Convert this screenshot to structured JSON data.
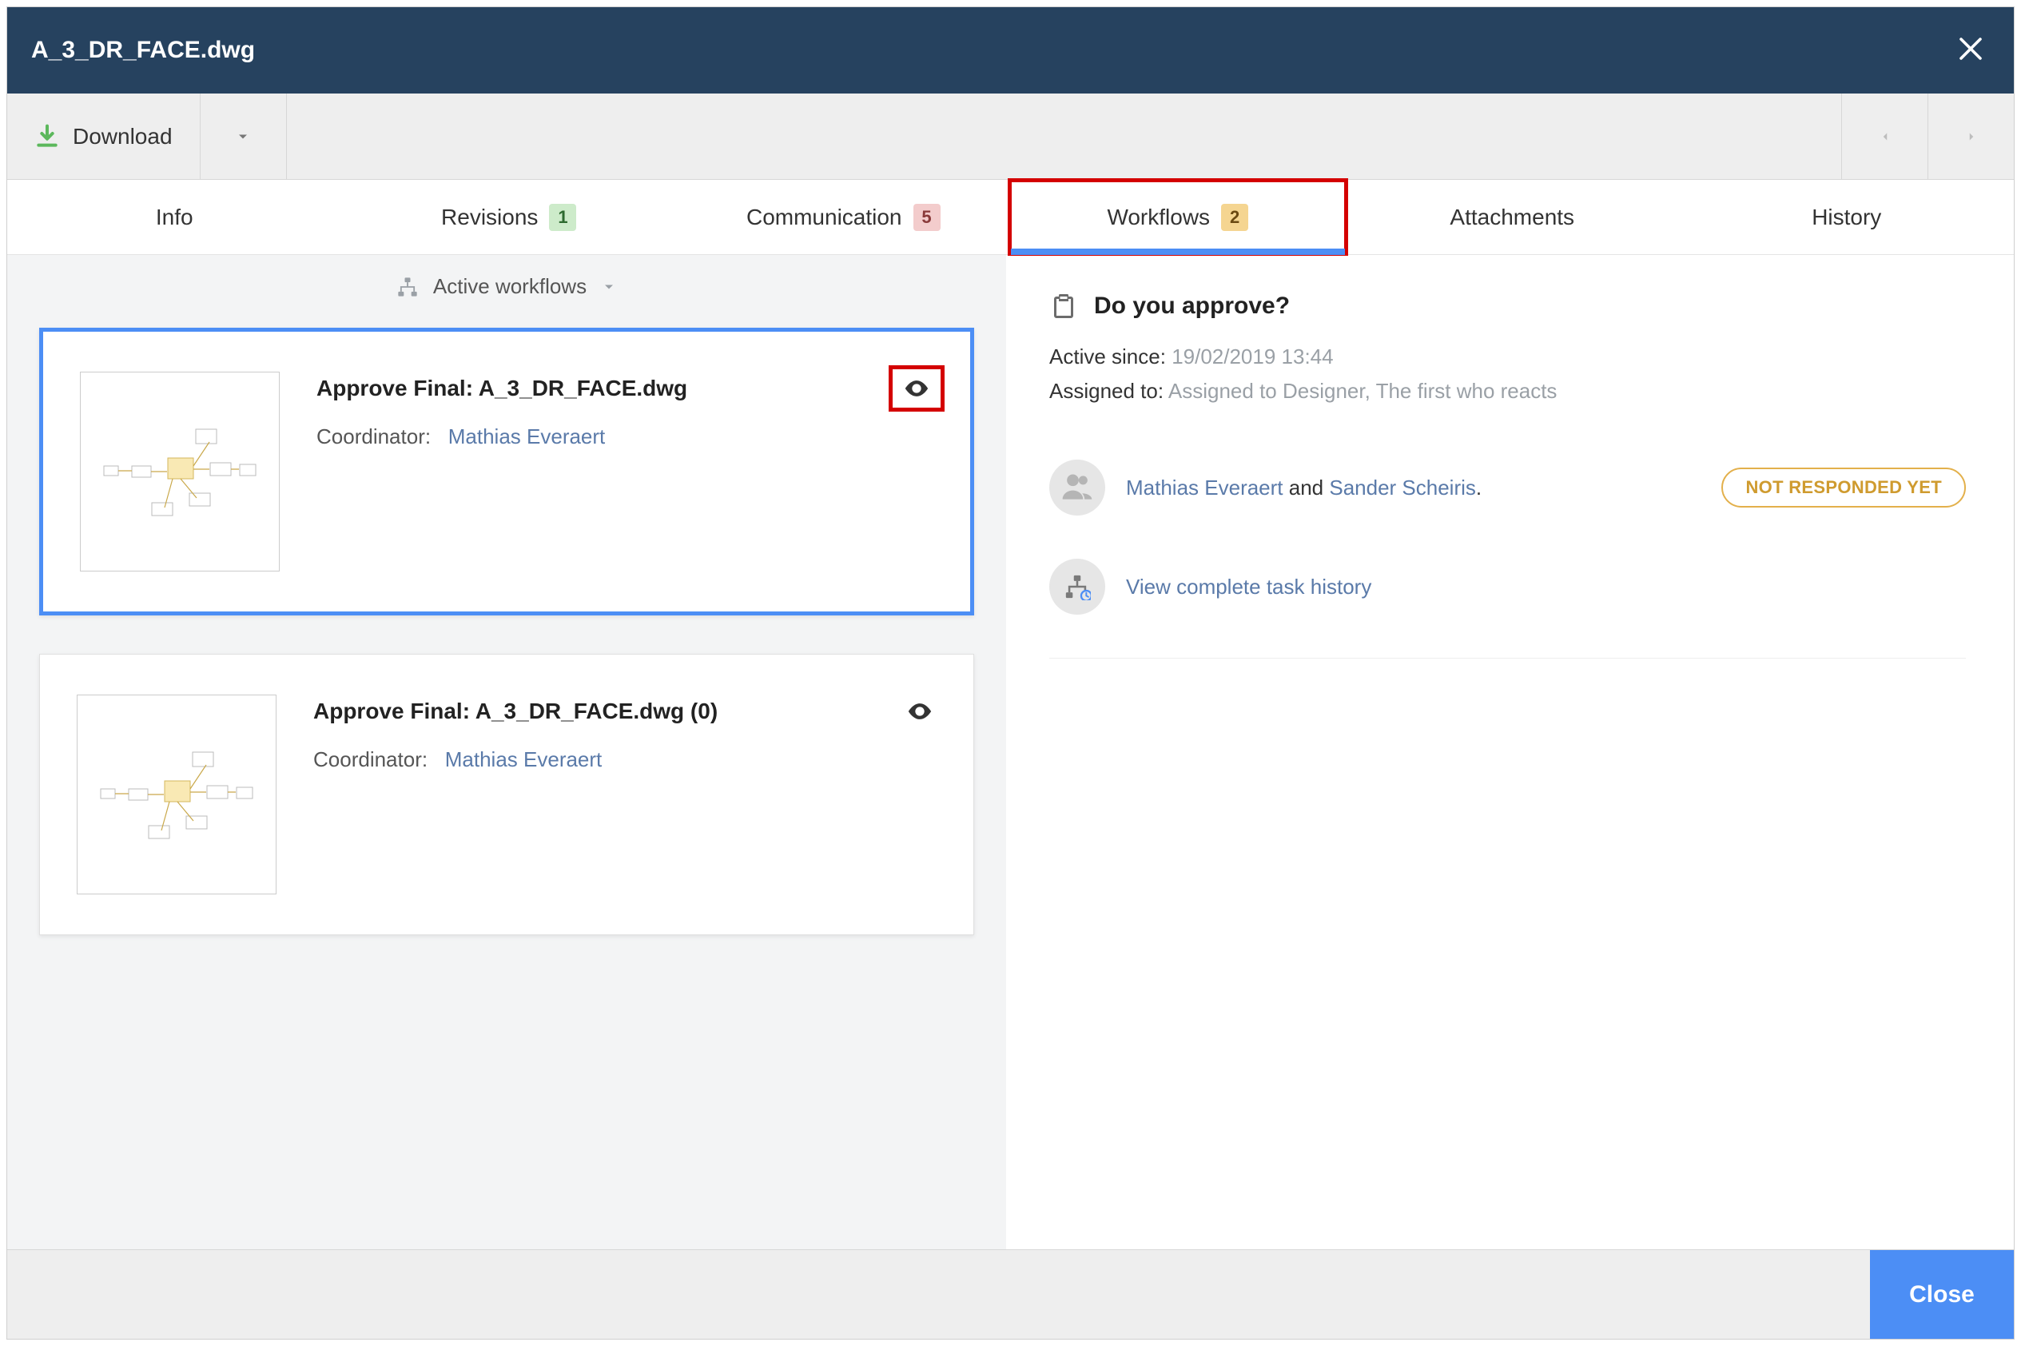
{
  "header": {
    "title": "A_3_DR_FACE.dwg"
  },
  "toolbar": {
    "download_label": "Download"
  },
  "tabs": {
    "info": "Info",
    "revisions": {
      "label": "Revisions",
      "count": "1"
    },
    "communication": {
      "label": "Communication",
      "count": "5"
    },
    "workflows": {
      "label": "Workflows",
      "count": "2"
    },
    "attachments": "Attachments",
    "history": "History"
  },
  "left": {
    "selector_label": "Active workflows",
    "cards": [
      {
        "title": "Approve Final: A_3_DR_FACE.dwg",
        "coordinator_label": "Coordinator:",
        "coordinator_name": "Mathias Everaert",
        "selected": true,
        "eye_highlighted": true
      },
      {
        "title": "Approve Final: A_3_DR_FACE.dwg (0)",
        "coordinator_label": "Coordinator:",
        "coordinator_name": "Mathias Everaert",
        "selected": false,
        "eye_highlighted": false
      }
    ]
  },
  "detail": {
    "title": "Do you approve?",
    "active_since_label": "Active since:",
    "active_since_value": "19/02/2019 13:44",
    "assigned_to_label": "Assigned to:",
    "assigned_to_value": "Assigned to Designer, The first who reacts",
    "person1": "Mathias Everaert",
    "and": " and ",
    "person2": "Sander Scheiris",
    "period": ".",
    "status": "NOT RESPONDED YET",
    "history_link": "View complete task history"
  },
  "footer": {
    "close": "Close"
  }
}
